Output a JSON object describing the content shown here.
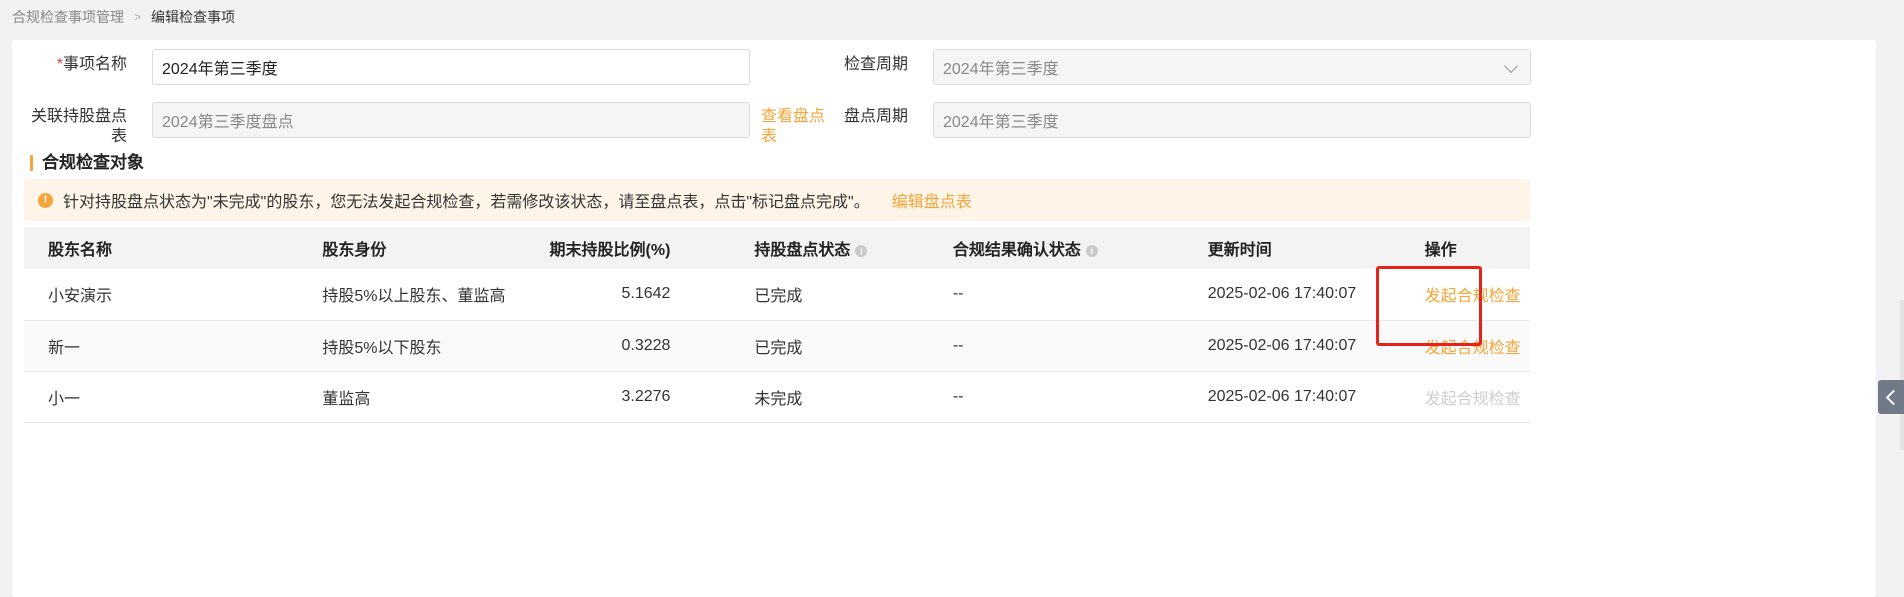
{
  "breadcrumb": {
    "parent": "合规检查事项管理",
    "separator": ">",
    "current": "编辑检查事项"
  },
  "form": {
    "item_name_required_mark": "*",
    "item_name_label": "事项名称",
    "item_name_value": "2024年第三季度",
    "check_period_label": "检查周期",
    "check_period_value": "2024年第三季度",
    "linked_sheet_label": "关联持股盘点表",
    "linked_sheet_value": "2024第三季度盘点",
    "view_sheet_link": "查看盘点表",
    "inventory_period_label": "盘点周期",
    "inventory_period_value": "2024年第三季度"
  },
  "section": {
    "title": "合规检查对象"
  },
  "alert": {
    "icon": "!",
    "message": "针对持股盘点状态为\"未完成\"的股东，您无法发起合规检查，若需修改该状态，请至盘点表，点击\"标记盘点完成\"。",
    "link": "编辑盘点表"
  },
  "table": {
    "headers": {
      "name": "股东名称",
      "identity": "股东身份",
      "ratio": "期末持股比例(%)",
      "inventory_status": "持股盘点状态",
      "confirm_status": "合规结果确认状态",
      "updated": "更新时间",
      "action": "操作"
    },
    "rows": [
      {
        "name": "小安演示",
        "identity": "持股5%以上股东、董监高",
        "ratio": "5.1642",
        "inventory_status": "已完成",
        "confirm_status": "--",
        "updated": "2025-02-06 17:40:07",
        "action": "发起合规检查"
      },
      {
        "name": "新一",
        "identity": "持股5%以下股东",
        "ratio": "0.3228",
        "inventory_status": "已完成",
        "confirm_status": "--",
        "updated": "2025-02-06 17:40:07",
        "action": "发起合规检查"
      },
      {
        "name": "小一",
        "identity": "董监高",
        "ratio": "3.2276",
        "inventory_status": "未完成",
        "confirm_status": "--",
        "updated": "2025-02-06 17:40:07",
        "action": "发起合规检查"
      }
    ]
  },
  "colors": {
    "accent": "#f5a53a",
    "alert_bg": "#fef4e8",
    "highlight": "#e5231b"
  },
  "icons": {
    "side_tab": "chevron-left-icon",
    "info": "info-icon",
    "dropdown": "chevron-down-icon"
  }
}
